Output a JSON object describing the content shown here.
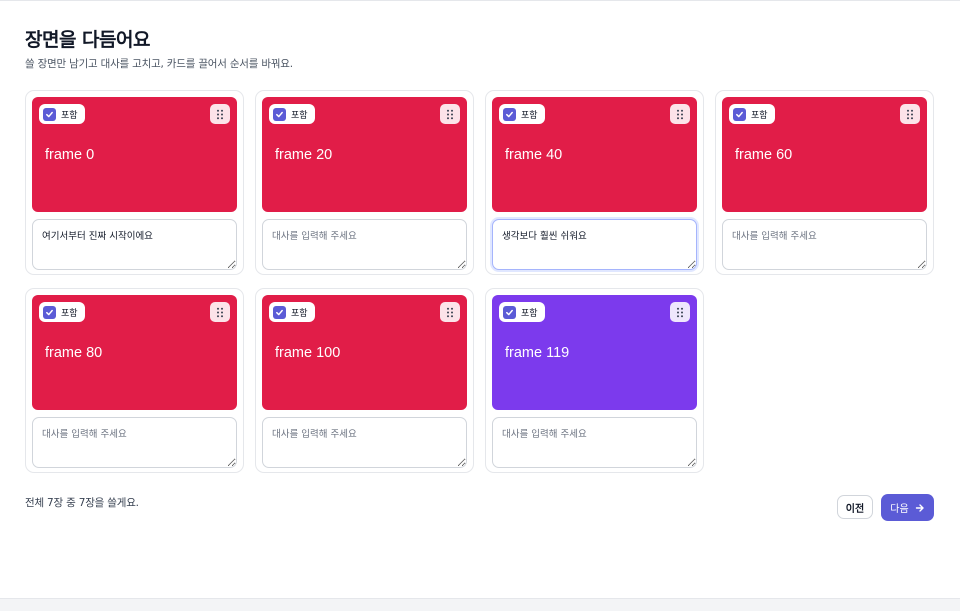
{
  "header": {
    "title": "장면을 다듬어요",
    "subtitle": "쓸 장면만 남기고 대사를 고치고, 카드를 끌어서 순서를 바꿔요."
  },
  "include_label": "포함",
  "caption_placeholder": "대사를 입력해 주세요",
  "cards": [
    {
      "frame_label": "frame 0",
      "color": "#e11d48",
      "included": true,
      "caption": "여기서부터 진짜 시작이에요",
      "focused": false
    },
    {
      "frame_label": "frame 20",
      "color": "#e11d48",
      "included": true,
      "caption": "",
      "focused": false
    },
    {
      "frame_label": "frame 40",
      "color": "#e11d48",
      "included": true,
      "caption": "생각보다 훨씬 쉬워요",
      "focused": true
    },
    {
      "frame_label": "frame 60",
      "color": "#e11d48",
      "included": true,
      "caption": "",
      "focused": false
    },
    {
      "frame_label": "frame 80",
      "color": "#e11d48",
      "included": true,
      "caption": "",
      "focused": false
    },
    {
      "frame_label": "frame 100",
      "color": "#e11d48",
      "included": true,
      "caption": "",
      "focused": false
    },
    {
      "frame_label": "frame 119",
      "color": "#7c3aed",
      "included": true,
      "caption": "",
      "focused": false
    }
  ],
  "footer": {
    "count_text": "전체 7장 중 7장을 쓸게요.",
    "prev_label": "이전",
    "next_label": "다음"
  },
  "colors": {
    "accent": "#5b5bd6",
    "frame_red": "#e11d48",
    "frame_purple": "#7c3aed"
  },
  "icons": {
    "checkbox": "check-icon",
    "drag": "drag-handle-icon",
    "next": "arrow-right-icon"
  }
}
